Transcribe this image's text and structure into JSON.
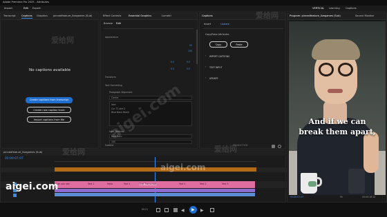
{
  "app": {
    "title": "Adobe Premiere Pro 2025 - Attributes",
    "menu": [
      "Import",
      "Edit",
      "Export"
    ],
    "workspace_tabs": [
      "VERTICAL",
      "Learning",
      "Captions"
    ]
  },
  "left_panel": {
    "tabs": [
      "Transcript",
      "Captions",
      "Graphics"
    ],
    "sequence": "pinnedfeature_livegames (Sub)",
    "empty_title": "No captions available",
    "buttons": [
      "Create captions from transcript",
      "Create new caption track",
      "Import captions from file"
    ]
  },
  "middle_panel": {
    "tabs": [
      "Effect Controls",
      "Essential Graphics",
      "Lumetri",
      "Audio Clip Mixer"
    ],
    "subtabs": [
      "Browse",
      "Edit"
    ],
    "sections": [
      "Appearance",
      "Transform",
      "Text Formatting",
      "Subtitle"
    ],
    "values": [
      "50",
      "100",
      "0.0",
      "0.0",
      "0.0",
      "0.0",
      "0",
      "0"
    ],
    "style_label": "Paragraph Alignment",
    "center": "Center",
    "text_items": [
      "Vert",
      "Cur T1 ab+2",
      "Blue Bank Blank"
    ],
    "font": "Inter Medium",
    "font_style": "Bold Italic",
    "font_size": "100"
  },
  "caption_panel": {
    "tabs": [
      "Captions",
      "Insert",
      "Update"
    ],
    "attr_title": "Copy/Paste Attributes",
    "copy": "Copy",
    "paste": "Paste",
    "sections": [
      "IMPORT CAPTIONS",
      "TEXT INPUT",
      "UPDATE"
    ]
  },
  "preview": {
    "tabs": [
      "Program: pinnedfeature_livegames (Sub)",
      "Source Monitor"
    ],
    "caption": [
      "And if we can",
      "break them apart,"
    ],
    "timecode": "00:00:07:07",
    "zoom": "Fit",
    "end_timecode": "00:00:18:12"
  },
  "timeline": {
    "tab": "pinnedfeature_livegames (Sub)",
    "timecode": "00:00:07:07",
    "clip_labels": [
      "Can you see",
      "Text 1",
      "Hello",
      "Text 1",
      "Text 2",
      "Chat Transcripts",
      "Text 1",
      "Text 2",
      "Text 3",
      "Text 1"
    ]
  },
  "status": {
    "timecode": "00:21",
    "chart": "PRODUCTION"
  },
  "watermark": {
    "site": "aigei.com",
    "cn": "爱给网"
  }
}
